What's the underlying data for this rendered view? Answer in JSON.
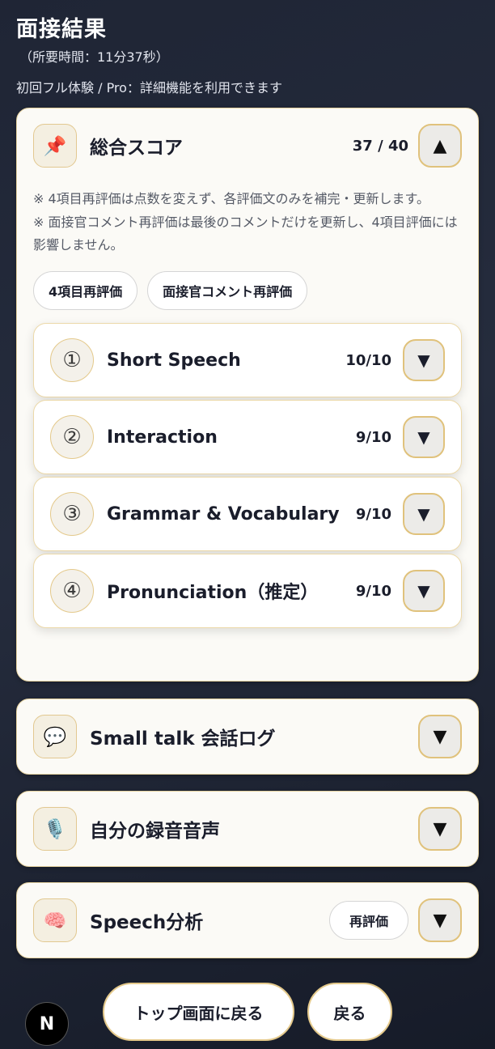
{
  "header": {
    "title": "面接結果",
    "duration": "（所要時間：11分37秒）",
    "plan": "初回フル体験 / Pro：詳細機能を利用できます"
  },
  "overall": {
    "icon": "📌",
    "title": "総合スコア",
    "score": "37 / 40",
    "toggle": "▲",
    "notes": [
      "※ 4項目再評価は点数を変えず、各評価文のみを補完・更新します。",
      "※ 面接官コメント再評価は最後のコメントだけを更新し、4項目評価には影響しません。"
    ],
    "buttons": {
      "rescore_items": "4項目再評価",
      "rescore_comment": "面接官コメント再評価"
    },
    "items": [
      {
        "num": "①",
        "title": "Short Speech",
        "score": "10/10",
        "toggle": "▼"
      },
      {
        "num": "②",
        "title": "Interaction",
        "score": "9/10",
        "toggle": "▼"
      },
      {
        "num": "③",
        "title": "Grammar & Vocabulary",
        "score": "9/10",
        "toggle": "▼"
      },
      {
        "num": "④",
        "title": "Pronunciation（推定）",
        "score": "9/10",
        "toggle": "▼"
      }
    ]
  },
  "sections": [
    {
      "icon": "💬",
      "title": "Small talk 会話ログ",
      "toggle": "▼"
    },
    {
      "icon": "🎙️",
      "title": "自分の録音音声",
      "toggle": "▼"
    },
    {
      "icon": "🧠",
      "title": "Speech分析",
      "action": "再評価",
      "toggle": "▼"
    }
  ],
  "footer": {
    "top_button": "トップ画面に戻る",
    "back_button": "戻る",
    "badge": "N"
  }
}
